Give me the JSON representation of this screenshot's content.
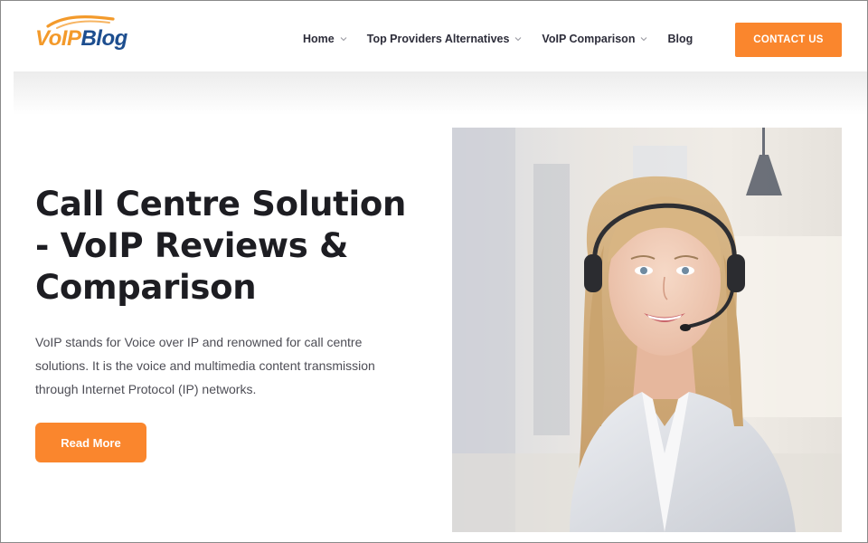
{
  "brand": {
    "part1": "VoIP",
    "part2": "Blog"
  },
  "nav": [
    {
      "label": "Home",
      "has_dropdown": true
    },
    {
      "label": "Top Providers Alternatives",
      "has_dropdown": true
    },
    {
      "label": "VoIP Comparison",
      "has_dropdown": true
    },
    {
      "label": "Blog",
      "has_dropdown": false
    }
  ],
  "header": {
    "cta_label": "CONTACT US"
  },
  "hero": {
    "title": "Call Centre Solution - VoIP Reviews & Comparison",
    "description": "VoIP stands for Voice over IP and renowned for call centre solutions. It is the voice and multimedia content transmission through Internet Protocol (IP) networks.",
    "button_label": "Read More",
    "image_icon": "call-centre-agent-photo"
  },
  "colors": {
    "accent": "#fa862d",
    "brand_orange": "#f39a2b",
    "brand_blue": "#1d4e8f",
    "heading": "#1d1d22",
    "body_text": "#4d4d55"
  }
}
